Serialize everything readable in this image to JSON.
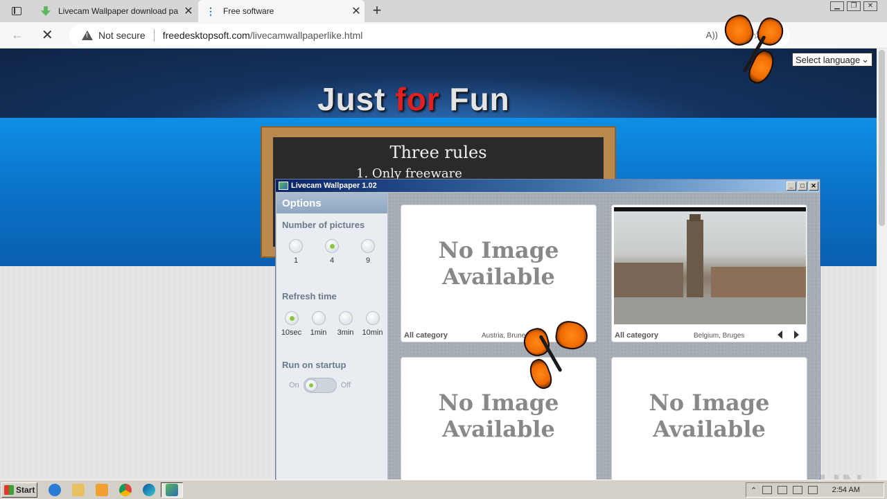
{
  "browser": {
    "tabs": [
      {
        "title": "Livecam Wallpaper download pa",
        "favicon": "download-icon",
        "active": false
      },
      {
        "title": "Free software",
        "favicon": "loading-dots-icon",
        "active": true
      }
    ],
    "address": {
      "security_label": "Not secure",
      "domain": "freedesktopsoft.com",
      "path": "/livecamwallpaperlike.html"
    }
  },
  "page": {
    "hero": {
      "title_a": "Just ",
      "title_b": "for",
      "title_c": " Fun"
    },
    "board": {
      "title": "Three rules",
      "rule1": "1. Only freeware"
    },
    "language_select": {
      "value": "Select language"
    }
  },
  "app": {
    "title": "Livecam Wallpaper 1.02",
    "sidebar": {
      "heading": "Options",
      "pictures": {
        "label": "Number of pictures",
        "options": [
          "1",
          "4",
          "9"
        ],
        "selected": "4"
      },
      "refresh": {
        "label": "Refresh time",
        "options": [
          "10sec",
          "1min",
          "3min",
          "10min"
        ],
        "selected": "10sec"
      },
      "startup": {
        "label": "Run on startup",
        "on": "On",
        "off": "Off",
        "value": "On"
      }
    },
    "cards": [
      {
        "no_image": "No Image Available",
        "line1": "No Image",
        "line2": "Available",
        "category": "All category",
        "location": "Austria, Bruneck"
      },
      {
        "category": "All category",
        "location": "Belgium, Bruges"
      },
      {
        "line1": "No Image",
        "line2": "Available"
      },
      {
        "line1": "No Image",
        "line2": "Available"
      }
    ]
  },
  "watermark": "ANY RUN",
  "taskbar": {
    "start_label": "Start",
    "clock": "2:54 AM"
  }
}
